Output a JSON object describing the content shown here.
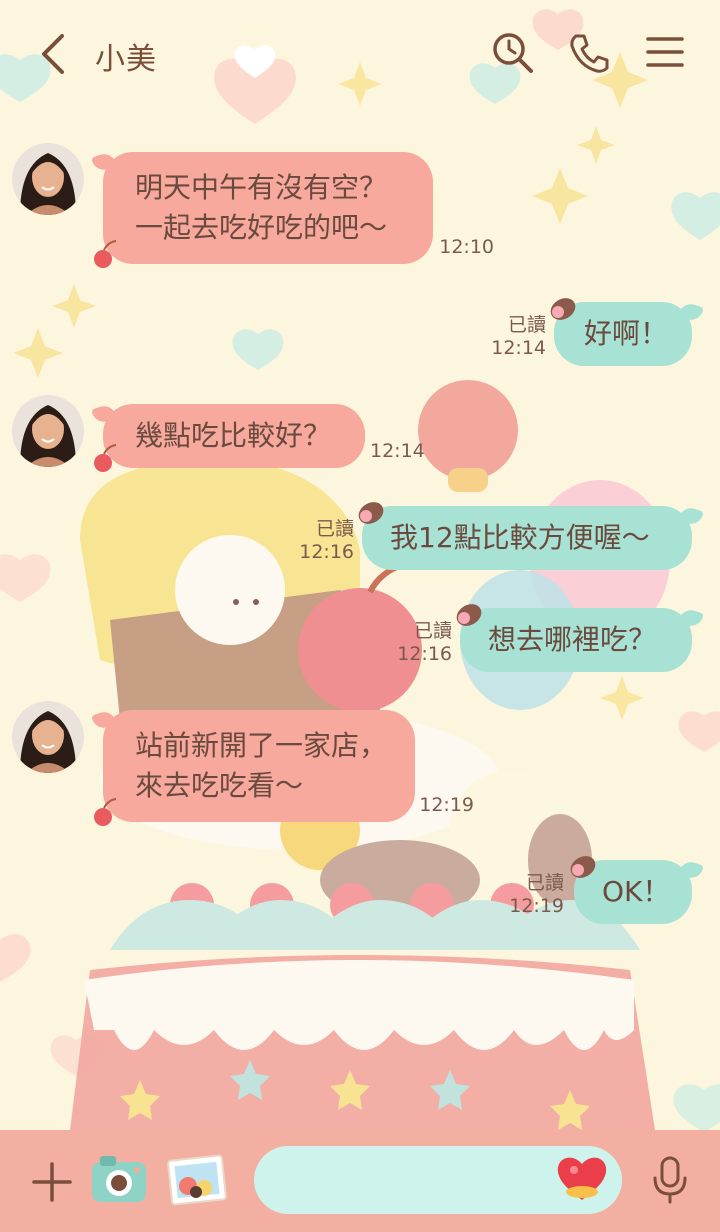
{
  "header": {
    "title": "小美",
    "icons": [
      "back-arrow-icon",
      "search-clock-icon",
      "phone-icon",
      "menu-icon"
    ]
  },
  "messages": [
    {
      "side": "in",
      "text": "明天中午有沒有空？\n一起去吃好吃的吧～",
      "time": "12:10"
    },
    {
      "side": "out",
      "text": "好啊！",
      "time": "12:14",
      "read": "已讀"
    },
    {
      "side": "in",
      "text": "幾點吃比較好？",
      "time": "12:14"
    },
    {
      "side": "out",
      "text": "我12點比較方便喔～",
      "time": "12:16",
      "read": "已讀"
    },
    {
      "side": "out",
      "text": "想去哪裡吃？",
      "time": "12:16",
      "read": "已讀"
    },
    {
      "side": "in",
      "text": "站前新開了一家店，\n來去吃吃看～",
      "time": "12:19"
    },
    {
      "side": "out",
      "text": "OK！",
      "time": "12:19",
      "read": "已讀"
    }
  ],
  "input_bar": {
    "icons": [
      "plus-icon",
      "camera-icon",
      "photo-album-icon",
      "heart-sticker-icon",
      "microphone-icon"
    ],
    "text_value": ""
  },
  "colors": {
    "background": "#fdf6de",
    "incoming_bubble": "#f6a99c",
    "outgoing_bubble": "#a8e2d4",
    "bottom_bar": "#f3b0a2",
    "input_field": "#cdf3ec",
    "icon_brown": "#7a4e3a"
  }
}
